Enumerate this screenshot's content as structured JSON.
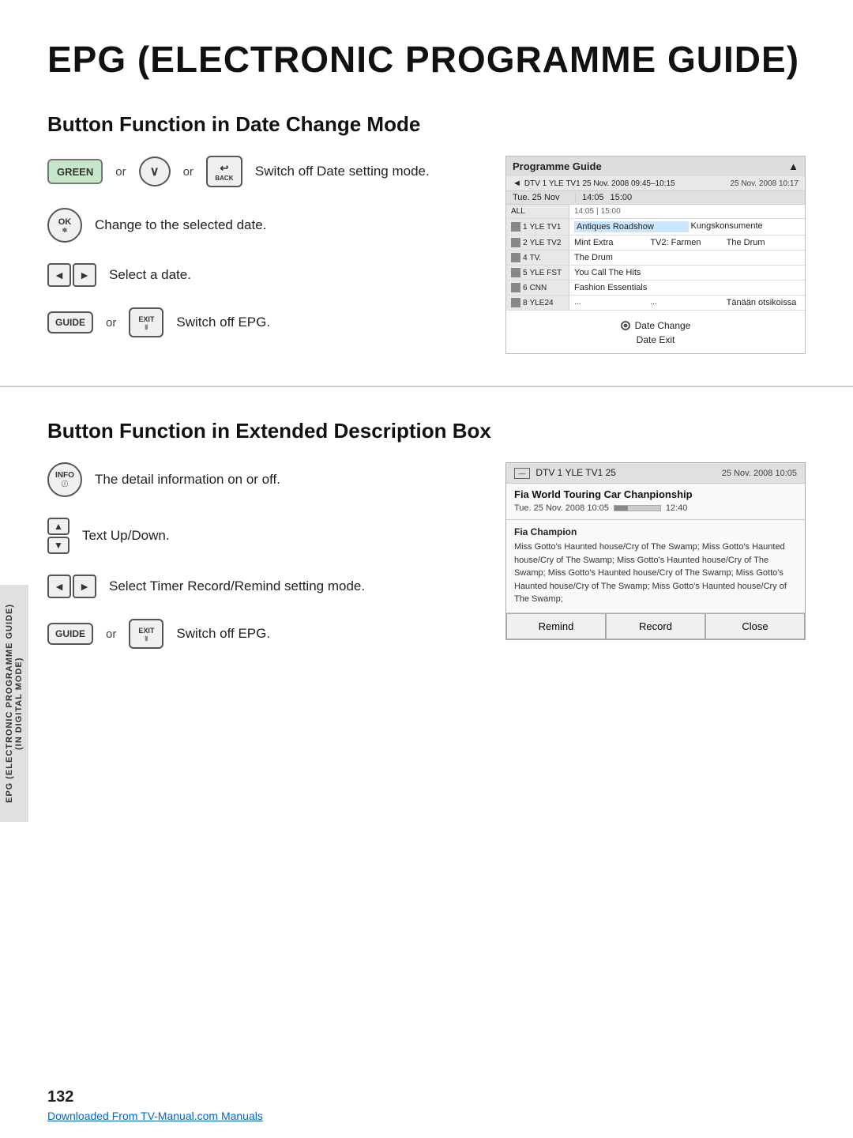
{
  "page": {
    "title": "EPG (ELECTRONIC PROGRAMME GUIDE)",
    "page_number": "132",
    "download_link": "Downloaded From TV-Manual.com Manuals"
  },
  "section1": {
    "title": "Button Function in Date Change Mode",
    "rows": [
      {
        "buttons": [
          "GREEN",
          "↓",
          "BACK"
        ],
        "text": "Switch off Date setting mode."
      },
      {
        "buttons": [
          "OK"
        ],
        "text": "Change to the selected date."
      },
      {
        "buttons": [
          "◄",
          "►"
        ],
        "text": "Select a date."
      },
      {
        "buttons": [
          "GUIDE",
          "EXIT"
        ],
        "text": "Switch off EPG."
      }
    ],
    "guide": {
      "title": "Programme Guide",
      "nav_left": "◄",
      "nav_right": "►",
      "date_display": "25 Nov. 2008 10:17",
      "current_channel": "DTV 1 YLE TV1 25 Nov. 2008 09:45–10:15",
      "date_row": "Tue. 25 Nov",
      "time_slots": [
        "14:05",
        "15:00"
      ],
      "all_label": "ALL",
      "channels": [
        {
          "num": "1",
          "name": "YLE TV1",
          "shows": [
            "Antiques Roadshow",
            "Kungskonsumente"
          ]
        },
        {
          "num": "2",
          "name": "YLE TV2",
          "shows": [
            "Mint Extra",
            "TV2: Farmen",
            "The Drum"
          ]
        },
        {
          "num": "4",
          "name": "TV.",
          "shows": [
            "The Drum"
          ]
        },
        {
          "num": "5",
          "name": "YLE FST",
          "shows": [
            "You Call The Hits"
          ]
        },
        {
          "num": "6",
          "name": "CNN",
          "shows": [
            "Fashion Essentials"
          ]
        },
        {
          "num": "8",
          "name": "YLE24",
          "shows": [
            "...",
            "...",
            "Tänään otsikoissa"
          ]
        }
      ],
      "footer_date_change": "Date Change",
      "footer_date_exit": "Date Exit"
    }
  },
  "section2": {
    "title": "Button Function in Extended Description Box",
    "rows": [
      {
        "button": "INFO",
        "text": "The detail information on or off."
      },
      {
        "button": "UP/DOWN",
        "text": "Text Up/Down."
      },
      {
        "button": "LR",
        "text": "Select Timer Record/Remind setting mode."
      },
      {
        "buttons": [
          "GUIDE",
          "EXIT"
        ],
        "text": "Switch off EPG."
      }
    ],
    "ext_box": {
      "channel": "DTV 1 YLE TV1 25",
      "date": "25 Nov. 2008 10:05",
      "program_title": "Fia World Touring Car Chanpionship",
      "time_str": "Tue. 25 Nov. 2008 10:05",
      "time_end": "12:40",
      "progress": 30,
      "desc_title": "Fia Champion",
      "desc_body": "Miss Gotto's Haunted house/Cry of The Swamp; Miss Gotto's Haunted house/Cry of The Swamp; Miss Gotto's Haunted house/Cry of The Swamp; Miss Gotto's Haunted house/Cry of The Swamp; Miss Gotto's Haunted house/Cry of The Swamp; Miss Gotto's Haunted house/Cry of The Swamp;",
      "btn_remind": "Remind",
      "btn_record": "Record",
      "btn_close": "Close"
    }
  },
  "side_label": "EPG (ELECTRONIC PROGRAMME GUIDE)\n(IN DIGITAL MODE)"
}
